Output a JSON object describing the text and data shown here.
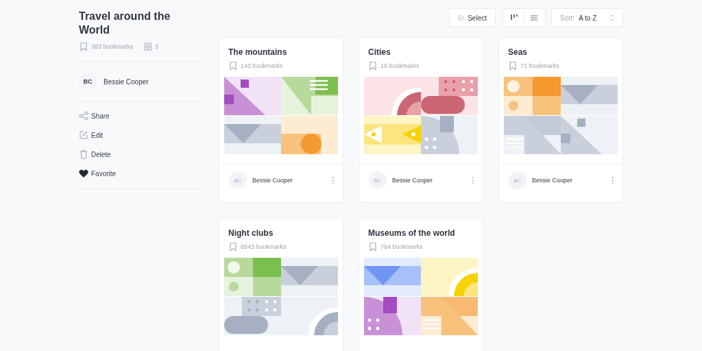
{
  "collection": {
    "title": "Travel around the World",
    "bookmarks": "383 bookmarks",
    "boards": "5"
  },
  "owner": {
    "initials": "BC",
    "name": "Bessie Cooper"
  },
  "actions": [
    {
      "label": "Share",
      "kind": "share"
    },
    {
      "label": "Edit",
      "kind": "edit"
    },
    {
      "label": "Delete",
      "kind": "delete"
    },
    {
      "label": "Favorite",
      "kind": "favorite",
      "on": true
    }
  ],
  "toolbar": {
    "select": "Select",
    "sort_label": "Sort:",
    "sort_value": "A to Z"
  },
  "cards": [
    {
      "title": "The mountains",
      "bookmarks": "143 bookmarks",
      "owner": {
        "initials": "BC",
        "name": "Bessie Cooper"
      }
    },
    {
      "title": "Cities",
      "bookmarks": "16 bookmarks",
      "owner": {
        "initials": "BC",
        "name": "Bessie Cooper"
      }
    },
    {
      "title": "Seas",
      "bookmarks": "71 bookmarks",
      "owner": {
        "initials": "BC",
        "name": "Bessie Cooper"
      }
    },
    {
      "title": "Night clubs",
      "bookmarks": "6543 bookmarks"
    },
    {
      "title": "Museums of the world",
      "bookmarks": "764 bookmarks"
    }
  ]
}
